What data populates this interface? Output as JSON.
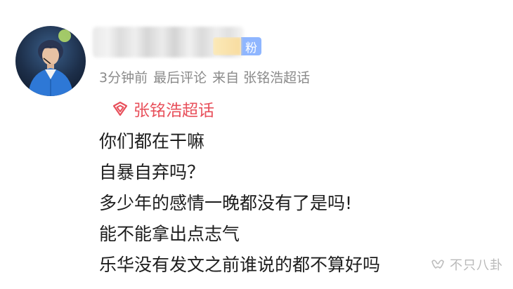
{
  "post": {
    "author": {
      "avatar": "avatar-photo",
      "fan_badge": "粉"
    },
    "meta": {
      "time": "3分钟前",
      "sort": "最后评论",
      "source": "来自 张铭浩超话"
    },
    "topic": {
      "icon": "supertopic-icon",
      "label": "张铭浩超话",
      "color": "#e8505b"
    },
    "content_lines": [
      "你们都在干嘛",
      "自暴自弃吗？",
      "多少年的感情一晚都没有了是吗!",
      "能不能拿出点志气",
      "乐华没有发文之前谁说的都不算好吗"
    ]
  },
  "watermark": {
    "icon": "wechat-channel-icon",
    "text": "不只八卦"
  },
  "colors": {
    "meta_text": "#8a8a8a",
    "body_text": "#1d1d1d",
    "badge_blue": "#8fb6ff",
    "topic_red": "#e8505b"
  }
}
